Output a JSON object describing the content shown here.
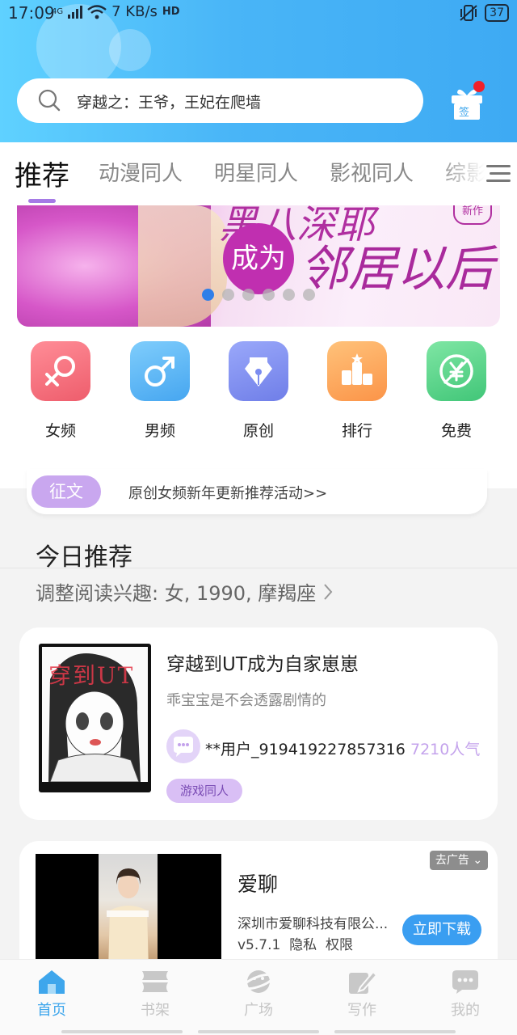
{
  "status_bar": {
    "time": "17:09",
    "network": "4G",
    "speed": "7 KB/s",
    "hd": "HD",
    "battery": "37"
  },
  "search": {
    "placeholder": "穿越之：王爷，王妃在爬墙"
  },
  "gift": {
    "label": "签"
  },
  "tabs": [
    {
      "label": "推荐",
      "active": true
    },
    {
      "label": "动漫同人"
    },
    {
      "label": "明星同人"
    },
    {
      "label": "影视同人"
    },
    {
      "label": "综影"
    }
  ],
  "banner": {
    "line1": "黑八深耶",
    "circle": "成为",
    "line2": "邻居以后",
    "badge": "新作",
    "current_slide": 1,
    "slide_count": 6
  },
  "categories": [
    {
      "label": "女频",
      "icon": "female-icon",
      "color": "#f06b76"
    },
    {
      "label": "男频",
      "icon": "male-icon",
      "color": "#58b5f5"
    },
    {
      "label": "原创",
      "icon": "pen-icon",
      "color": "#7b8cf0"
    },
    {
      "label": "排行",
      "icon": "podium-icon",
      "color": "#fba657"
    },
    {
      "label": "免费",
      "icon": "yuan-icon",
      "color": "#52d28a"
    }
  ],
  "notice": {
    "pill": "征文",
    "text": "原创女频新年更新推荐活动>>"
  },
  "today": {
    "title": "今日推荐",
    "interest": "调整阅读兴趣: 女, 1990, 摩羯座"
  },
  "book": {
    "title": "穿越到UT成为自家崽崽",
    "desc": "乖宝宝是不会透露剧情的",
    "author": "**用户_919419227857316",
    "popularity": "7210人气",
    "tag": "游戏同人",
    "cover_text": "穿到UT"
  },
  "ad": {
    "name": "爱聊",
    "company": "深圳市爱聊科技有限公...",
    "version": "v5.7.1",
    "privacy": "隐私",
    "permission": "权限",
    "close": "去广告",
    "download": "立即下载"
  },
  "bottom_nav": [
    {
      "label": "首页",
      "icon": "home-icon",
      "active": true
    },
    {
      "label": "书架",
      "icon": "bookshelf-icon"
    },
    {
      "label": "广场",
      "icon": "planet-icon"
    },
    {
      "label": "写作",
      "icon": "write-icon"
    },
    {
      "label": "我的",
      "icon": "chat-bubble-icon"
    }
  ],
  "colors": {
    "header_gradient_start": "#5fd1ff",
    "header_gradient_end": "#3eaaf3",
    "accent_purple": "#a57ae6",
    "nav_active": "#3ea6ec"
  }
}
